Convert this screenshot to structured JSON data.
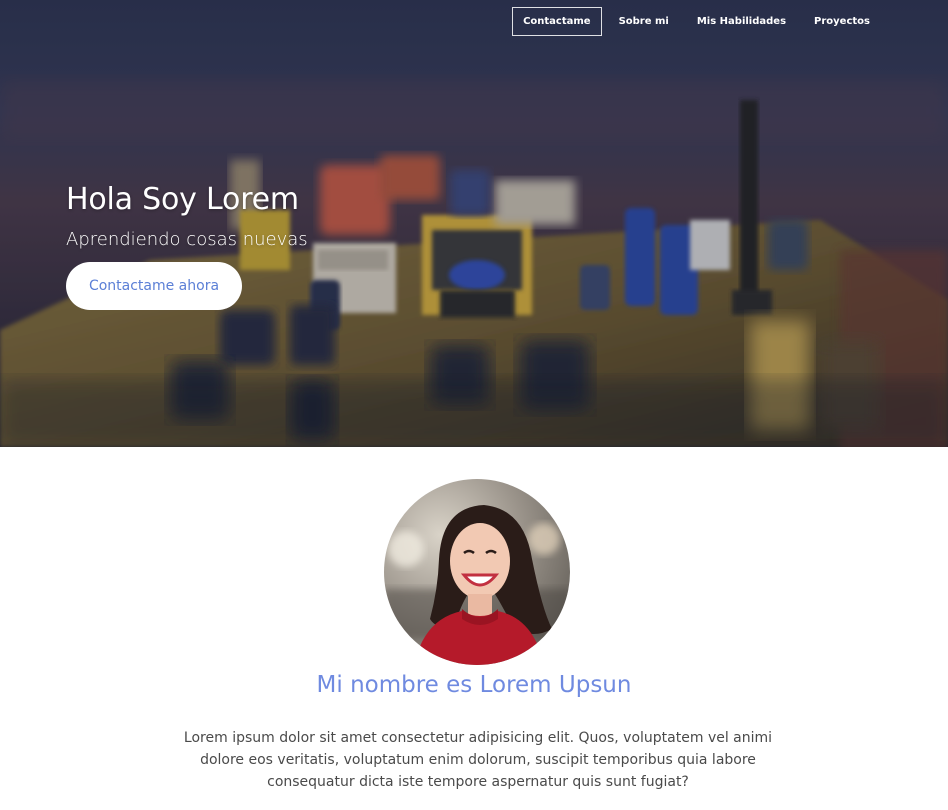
{
  "nav": {
    "items": [
      {
        "label": "Contactame",
        "active": true
      },
      {
        "label": "Sobre mi",
        "active": false
      },
      {
        "label": "Mis Habilidades",
        "active": false
      },
      {
        "label": "Proyectos",
        "active": false
      }
    ]
  },
  "hero": {
    "title": "Hola Soy Lorem",
    "subtitle": "Aprendiendo cosas nuevas",
    "cta_label": "Contactame ahora",
    "background_image": "circuit-board-photo"
  },
  "about": {
    "avatar_image": "smiling-woman-portrait",
    "name": "Mi nombre es Lorem Upsun",
    "description": "Lorem ipsum dolor sit amet consectetur adipisicing elit. Quos, voluptatem vel animi dolore eos veritatis, voluptatum enim dolorum, suscipit temporibus quia labore consequatur dicta iste tempore aspernatur quis sunt fugiat?"
  },
  "colors": {
    "accent": "#6f8ae0",
    "button_text": "#5b7fd6",
    "body_text": "#4a4a4a"
  }
}
